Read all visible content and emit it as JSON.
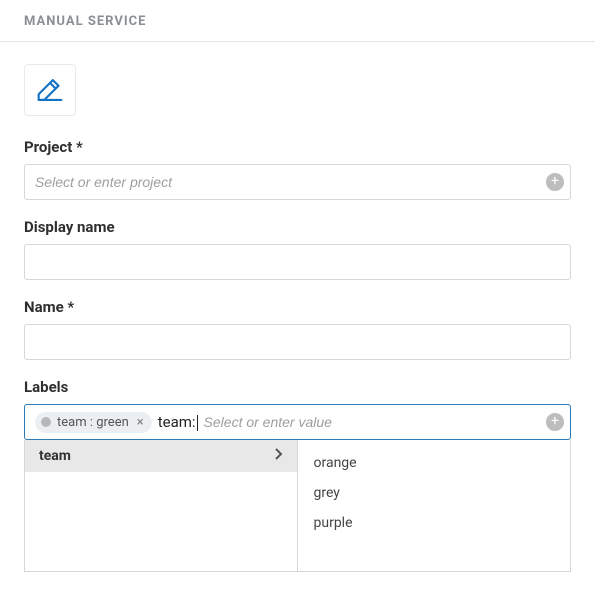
{
  "header": {
    "title": "MANUAL SERVICE"
  },
  "fields": {
    "project": {
      "label": "Project *",
      "placeholder": "Select or enter project",
      "value": ""
    },
    "display_name": {
      "label": "Display name",
      "value": ""
    },
    "name": {
      "label": "Name *",
      "value": ""
    },
    "labels": {
      "label": "Labels",
      "chips": [
        {
          "key": "team",
          "value": "green",
          "display": "team : green"
        }
      ],
      "typed": "team:",
      "placeholder": "Select or enter value",
      "suggest_key": "team",
      "suggest_values": [
        "orange",
        "grey",
        "purple"
      ]
    }
  }
}
